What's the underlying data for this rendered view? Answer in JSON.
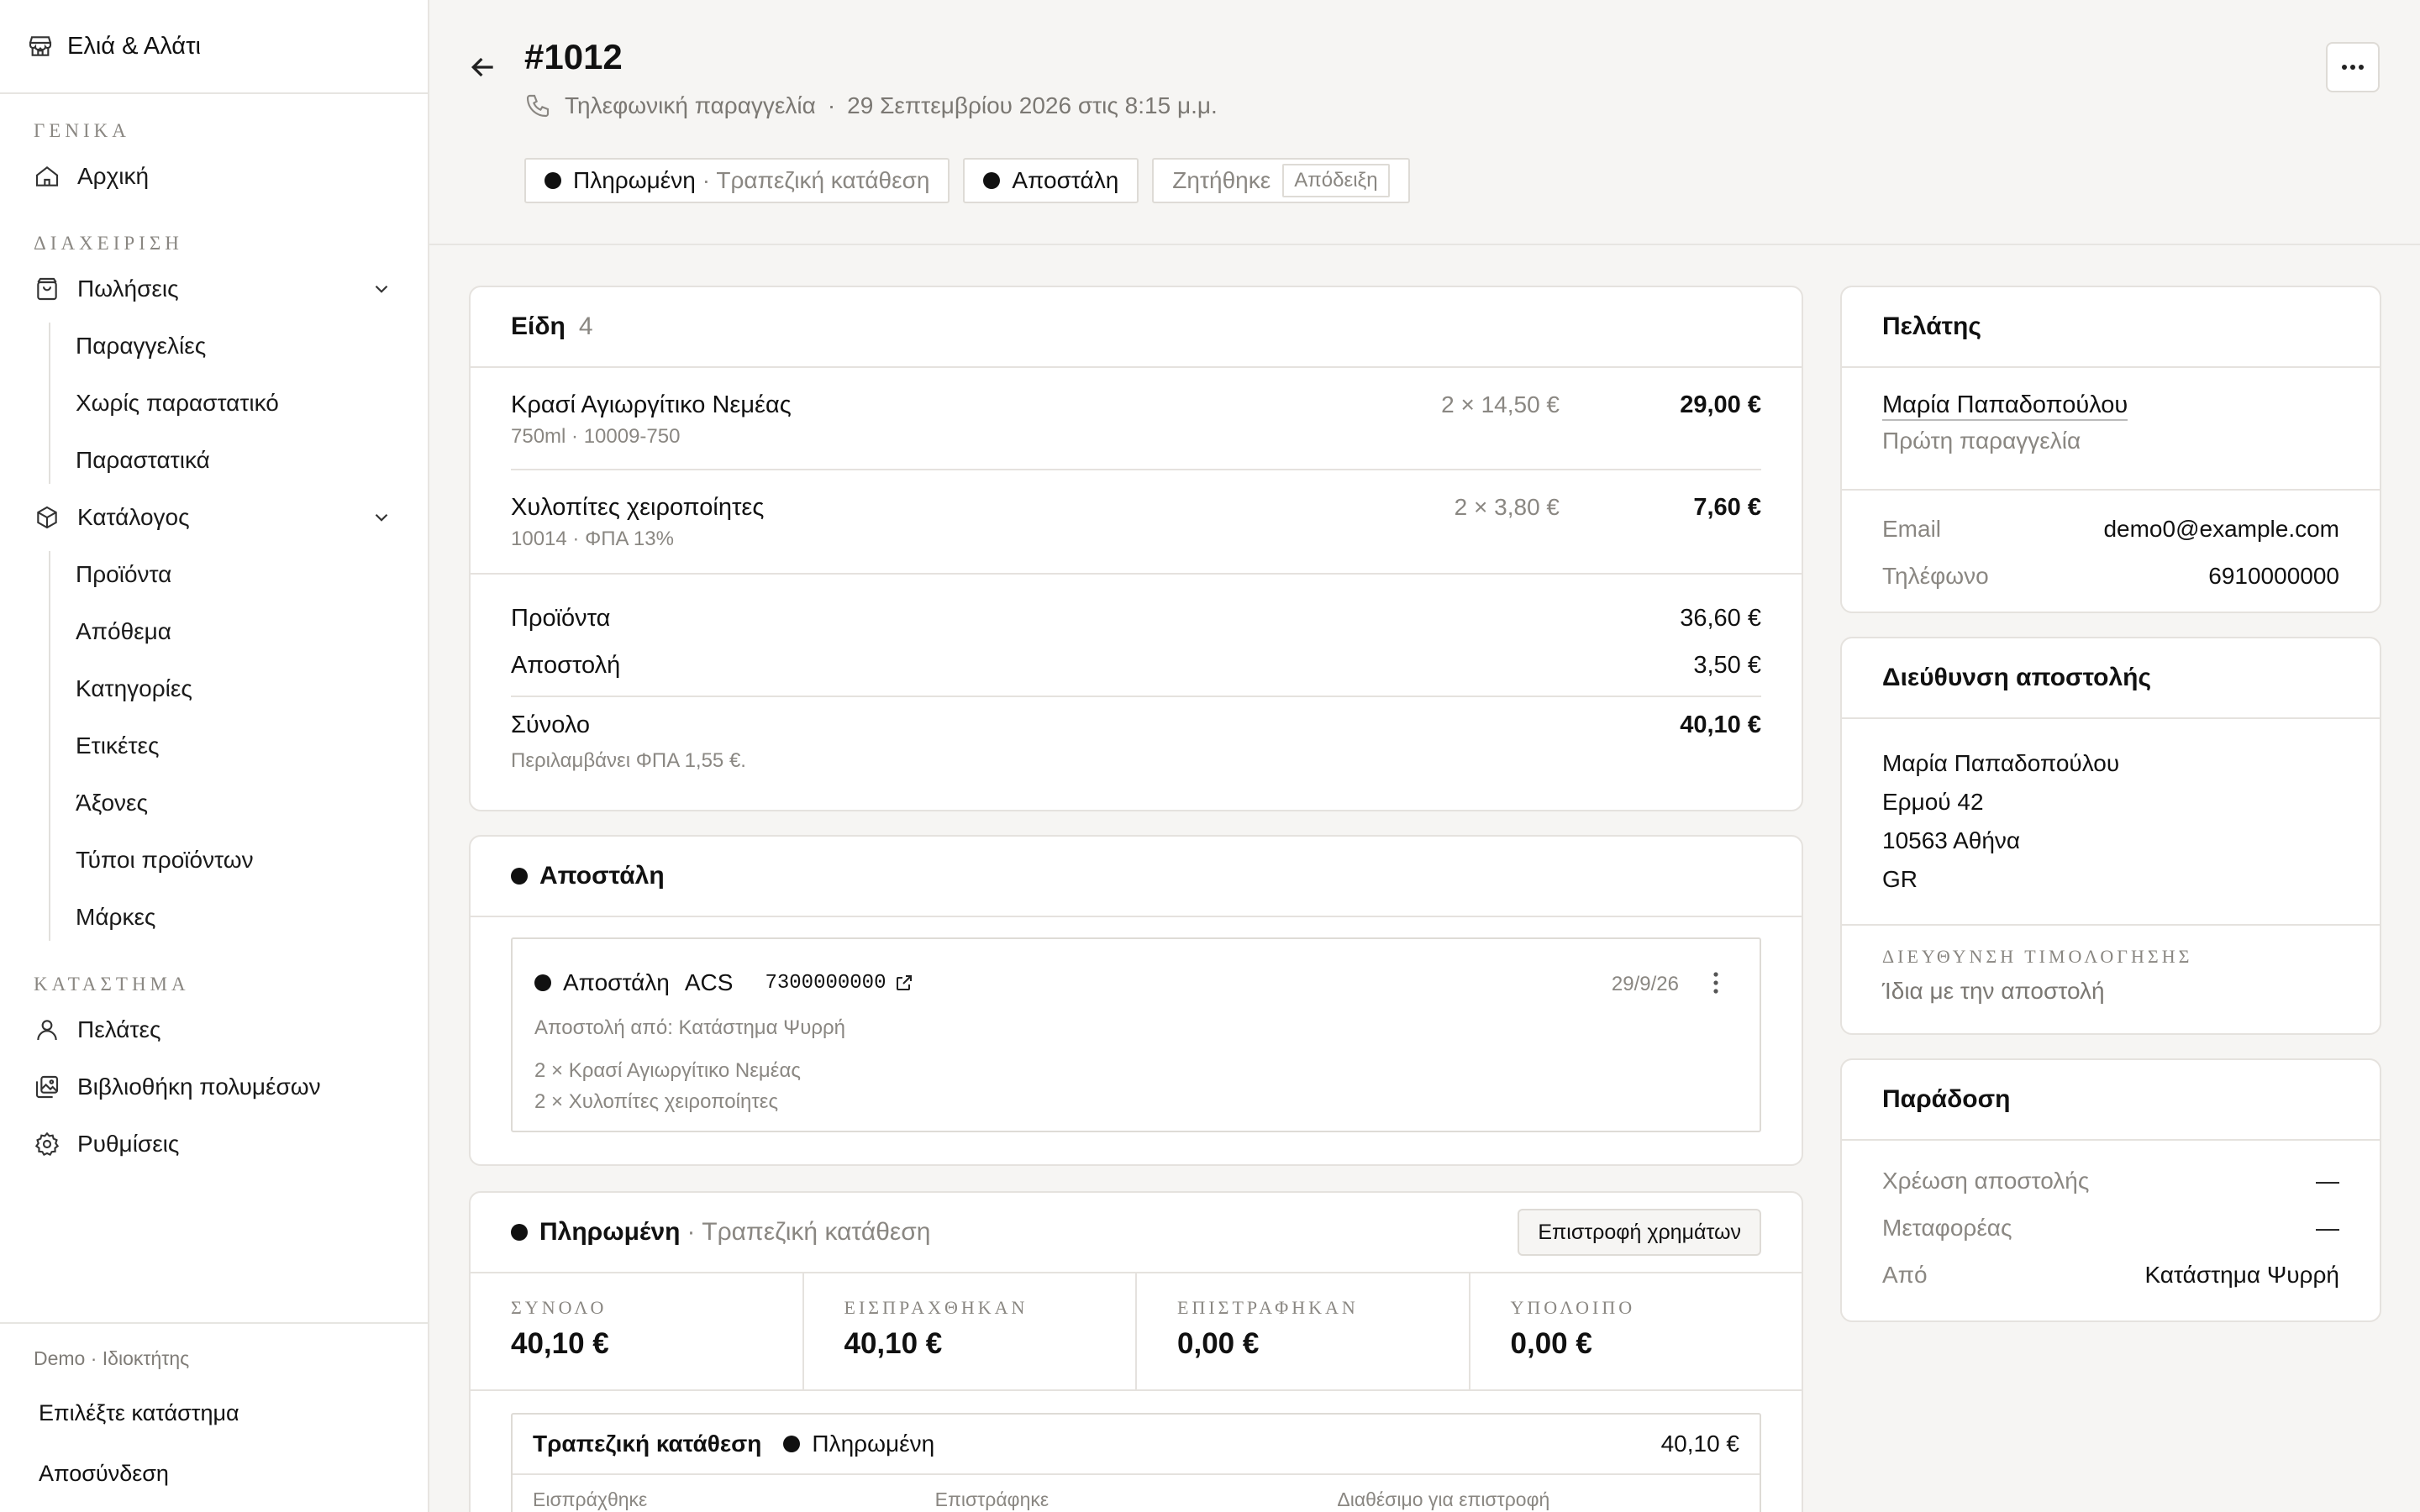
{
  "brand": {
    "name": "Ελιά & Αλάτι"
  },
  "nav": {
    "section_general": "ΓΕΝΙΚΑ",
    "home": "Αρχική",
    "section_manage": "ΔΙΑΧΕΙΡΙΣΗ",
    "sales": "Πωλήσεις",
    "sales_items": [
      "Παραγγελίες",
      "Χωρίς παραστατικό",
      "Παραστατικά"
    ],
    "catalog": "Κατάλογος",
    "catalog_items": [
      "Προϊόντα",
      "Απόθεμα",
      "Κατηγορίες",
      "Ετικέτες",
      "Άξονες",
      "Τύποι προϊόντων",
      "Μάρκες"
    ],
    "section_store": "ΚΑΤΑΣΤΗΜΑ",
    "customers": "Πελάτες",
    "media": "Βιβλιοθήκη πολυμέσων",
    "settings": "Ρυθμίσεις"
  },
  "footer": {
    "user": "Demo · Ιδιοκτήτης",
    "choose_store": "Επιλέξτε κατάστημα",
    "logout": "Αποσύνδεση"
  },
  "order": {
    "number": "#1012",
    "channel": "Τηλεφωνική παραγγελία",
    "date": "29 Σεπτεμβρίου 2026 στις 8:15 μ.μ.",
    "sep": "·",
    "badge_paid": "Πληρωμένη",
    "badge_paid_method": "· Τραπεζική κατάθεση",
    "badge_shipped": "Αποστάλη",
    "badge_requested": "Ζητήθηκε",
    "badge_receipt": "Απόδειξη"
  },
  "items": {
    "title": "Είδη",
    "count": "4",
    "lines": [
      {
        "name": "Κρασί Αγιωργίτικο Νεμέας",
        "sub": "750ml · 10009-750",
        "qty": "2 × 14,50 €",
        "total": "29,00 €"
      },
      {
        "name": "Χυλοπίτες χειροποίητες",
        "sub": "10014 · ΦΠΑ 13%",
        "qty": "2 × 3,80 €",
        "total": "7,60 €"
      }
    ],
    "products_label": "Προϊόντα",
    "products_value": "36,60 €",
    "shipping_label": "Αποστολή",
    "shipping_value": "3,50 €",
    "total_label": "Σύνολο",
    "total_value": "40,10 €",
    "tax_note": "Περιλαμβάνει ΦΠΑ 1,55 €."
  },
  "fulfillment": {
    "title": "Αποστάλη",
    "status": "Αποστάλη",
    "carrier": "ACS",
    "tracking": "7300000000",
    "date": "29/9/26",
    "from": "Αποστολή από: Κατάστημα Ψυρρή",
    "items": [
      "2 × Κρασί Αγιωργίτικο Νεμέας",
      "2 × Χυλοπίτες χειροποίητες"
    ]
  },
  "payment": {
    "title": "Πληρωμένη",
    "method": "· Τραπεζική κατάθεση",
    "refund_button": "Επιστροφή χρημάτων",
    "stats": [
      {
        "label": "ΣΥΝΟΛΟ",
        "value": "40,10 €"
      },
      {
        "label": "ΕΙΣΠΡΑΧΘΗΚΑΝ",
        "value": "40,10 €"
      },
      {
        "label": "ΕΠΙΣΤΡΑΦΗΚΑΝ",
        "value": "0,00 €"
      },
      {
        "label": "ΥΠΟΛΟΙΠΟ",
        "value": "0,00 €"
      }
    ],
    "txn_method": "Τραπεζική κατάθεση",
    "txn_status": "Πληρωμένη",
    "txn_amount": "40,10 €",
    "txn_cols": [
      "Εισπράχθηκε",
      "Επιστράφηκε",
      "Διαθέσιμο για επιστροφή"
    ]
  },
  "customer": {
    "title": "Πελάτης",
    "name": "Μαρία Παπαδοπούλου",
    "note": "Πρώτη παραγγελία",
    "email_label": "Email",
    "email": "demo0@example.com",
    "phone_label": "Τηλέφωνο",
    "phone": "6910000000"
  },
  "shipping_address": {
    "title": "Διεύθυνση αποστολής",
    "lines": [
      "Μαρία Παπαδοπούλου",
      "Ερμού 42",
      "10563 Αθήνα",
      "GR"
    ],
    "billing_title": "ΔΙΕΥΘΥΝΣΗ ΤΙΜΟΛΟΓΗΣΗΣ",
    "billing_value": "Ίδια με την αποστολή"
  },
  "delivery": {
    "title": "Παράδοση",
    "rows": [
      {
        "label": "Χρέωση αποστολής",
        "value": "—"
      },
      {
        "label": "Μεταφορέας",
        "value": "—"
      },
      {
        "label": "Από",
        "value": "Κατάστημα Ψυρρή"
      }
    ]
  }
}
